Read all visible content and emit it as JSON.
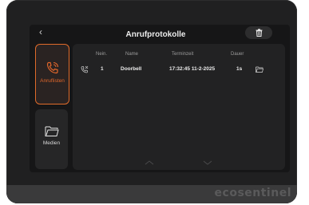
{
  "header": {
    "back_glyph": "‹",
    "title": "Anrufprotokolle",
    "delete_icon": "trash-icon"
  },
  "sidebar": {
    "items": [
      {
        "label": "Anruflisten",
        "icon": "phone-call-icon",
        "active": true
      },
      {
        "label": "Medien",
        "icon": "folder-icon",
        "active": false
      }
    ]
  },
  "table": {
    "columns": [
      "Nein.",
      "Name",
      "Terminzeit",
      "Dauer"
    ],
    "rows": [
      {
        "type_icon": "missed-call-icon",
        "number": "1",
        "name": "Doorbell",
        "time": "17:32:45 11-2-2025",
        "duration": "1s",
        "media_icon": "folder-icon"
      }
    ]
  },
  "brand": {
    "text": "ecosentinel"
  },
  "colors": {
    "accent": "#e0662b",
    "screen_bg": "#161617",
    "panel_bg": "#222223"
  }
}
